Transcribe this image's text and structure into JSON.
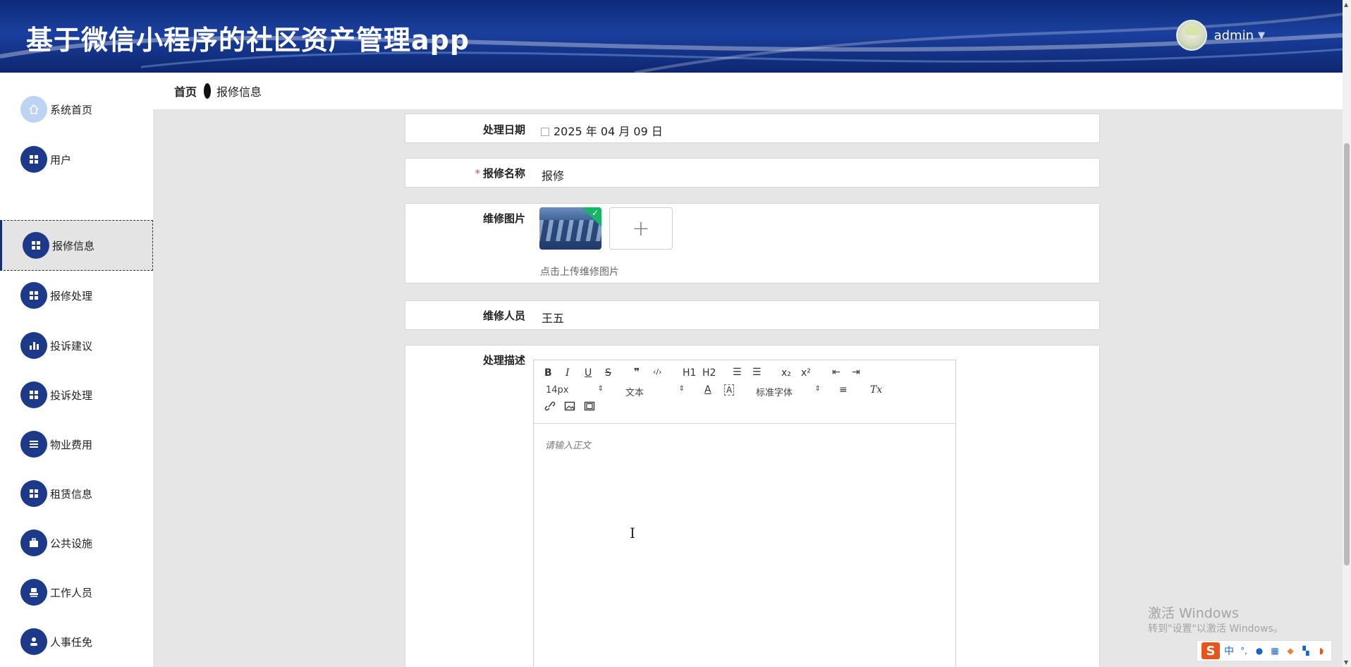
{
  "header": {
    "title": "基于微信小程序的社区资产管理app",
    "username": "admin",
    "caret": "▼"
  },
  "sidebar": {
    "items": [
      {
        "label": "系统首页",
        "icon": "home-icon",
        "active": false
      },
      {
        "label": "用户",
        "icon": "grid-icon",
        "active": false
      },
      {
        "label": "报修信息",
        "icon": "grid-icon",
        "active": true
      },
      {
        "label": "报修处理",
        "icon": "grid-icon",
        "active": false
      },
      {
        "label": "投诉建议",
        "icon": "bar-chart-icon",
        "active": false
      },
      {
        "label": "投诉处理",
        "icon": "grid-icon",
        "active": false
      },
      {
        "label": "物业费用",
        "icon": "list-icon",
        "active": false
      },
      {
        "label": "租赁信息",
        "icon": "grid-icon",
        "active": false
      },
      {
        "label": "公共设施",
        "icon": "briefcase-icon",
        "active": false
      },
      {
        "label": "工作人员",
        "icon": "stamp-icon",
        "active": false
      },
      {
        "label": "人事任免",
        "icon": "person-icon",
        "active": false
      }
    ]
  },
  "breadcrumb": {
    "home": "首页",
    "current": "报修信息"
  },
  "form": {
    "date": {
      "label": "处理日期",
      "value": "2025 年 04 月 09 日"
    },
    "name": {
      "label": "报修名称",
      "required_mark": "*",
      "value": "报修"
    },
    "image": {
      "label": "维修图片",
      "tip": "点击上传维修图片",
      "add_symbol": "+"
    },
    "staff": {
      "label": "维修人员",
      "value": "王五"
    },
    "description": {
      "label": "处理描述",
      "placeholder": "请输入正文"
    }
  },
  "editor": {
    "toolbar": {
      "bold": "B",
      "italic": "I",
      "underline": "U",
      "strike": "S",
      "quote": "❞",
      "code": "‹/›",
      "h1": "H1",
      "h2": "H2",
      "ordered_list": "☰",
      "bullet_list": "☰",
      "subscript": "x₂",
      "superscript": "x²",
      "outdent": "⇤",
      "indent": "⇥",
      "size": "14px",
      "paragraph": "文本",
      "color": "A",
      "background": "A",
      "font": "标准字体",
      "align": "≡",
      "clear": "Tx",
      "link": "🔗",
      "image": "▣",
      "video": "▤"
    }
  },
  "watermark": {
    "title": "激活 Windows",
    "subtitle": "转到\"设置\"以激活 Windows。"
  },
  "ime": {
    "logo": "S",
    "mode": "中"
  },
  "colors": {
    "header_bg": "#14307f",
    "menu_icon_bg": "#1d3a8a",
    "main_bg": "#e6e6e6",
    "required": "#e04b4b",
    "upload_badge": "#18b565"
  }
}
